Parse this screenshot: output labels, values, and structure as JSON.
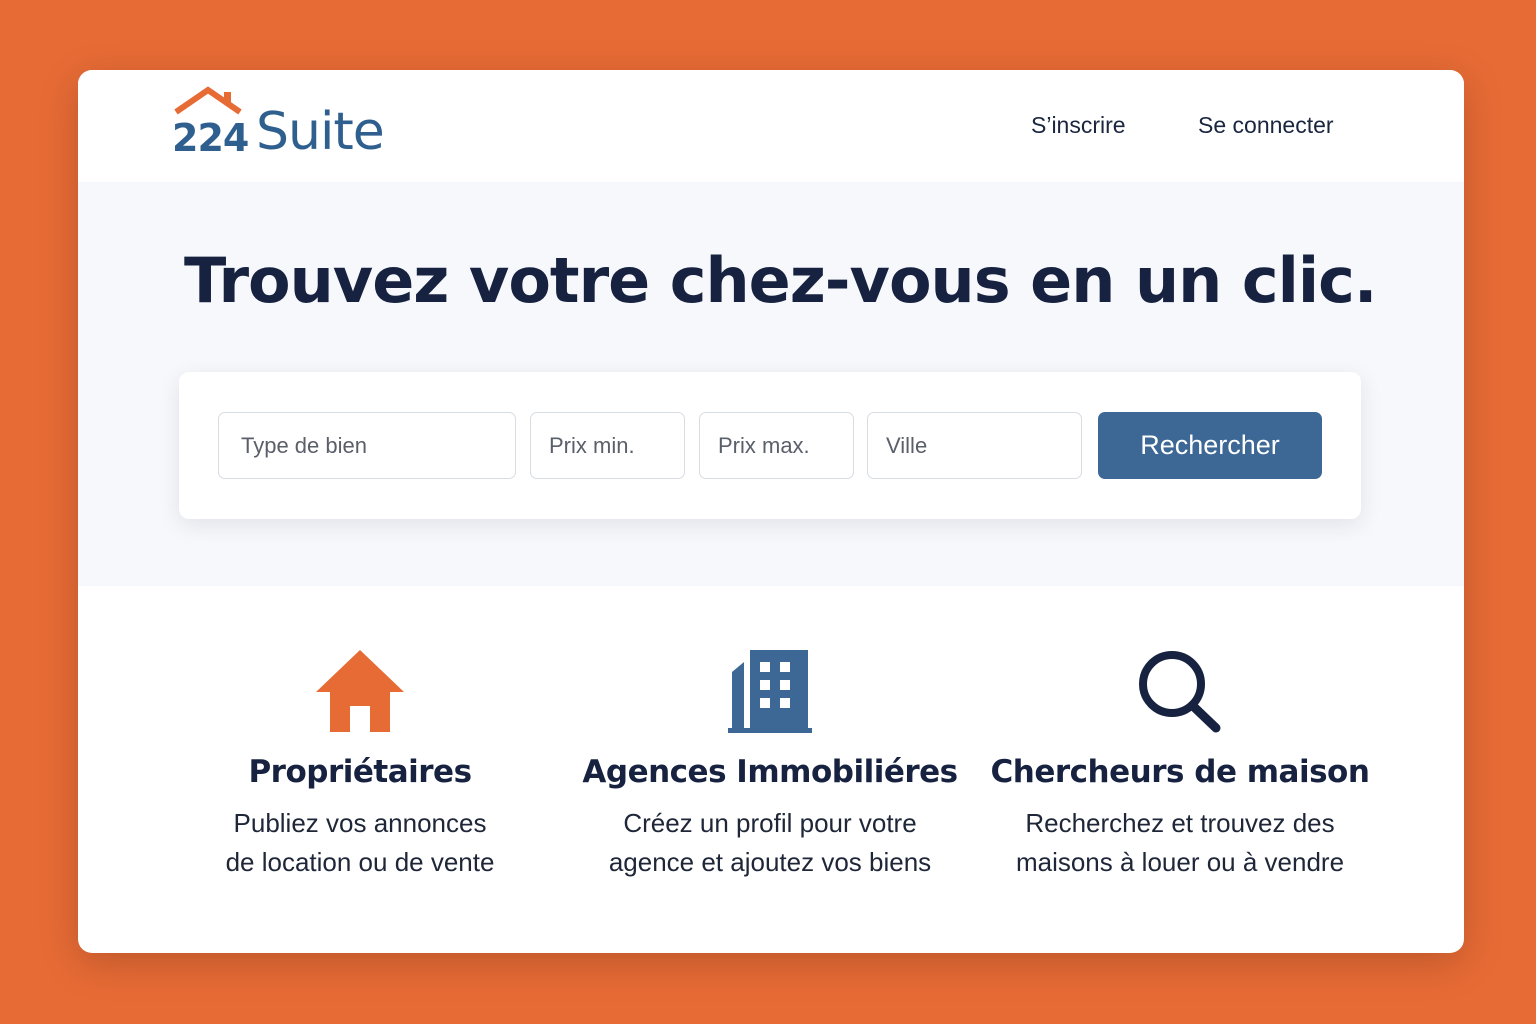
{
  "brand": {
    "number": "224",
    "name": "Suite",
    "primary_color": "#2E5F8E",
    "accent_color": "#E76B35"
  },
  "nav": {
    "signup": "S’inscrire",
    "login": "Se connecter"
  },
  "hero": {
    "title": "Trouvez votre chez-vous en un clic."
  },
  "search": {
    "type_placeholder": "Type de bien",
    "min_price_placeholder": "Prix min.",
    "max_price_placeholder": "Prix max.",
    "city_placeholder": "Ville",
    "button_label": "Rechercher",
    "button_color": "#3D6895"
  },
  "features": [
    {
      "icon": "house-icon",
      "title": "Propriétaires",
      "line1": "Publiez vos annonces",
      "line2": "de location ou de vente"
    },
    {
      "icon": "building-icon",
      "title": "Agences Immobiliéres",
      "line1": "Créez un profil pour votre",
      "line2": "agence et ajoutez vos biens"
    },
    {
      "icon": "search-icon",
      "title": "Chercheurs de maison",
      "line1": "Recherchez et trouvez des",
      "line2": "maisons à louer ou à vendre"
    }
  ]
}
